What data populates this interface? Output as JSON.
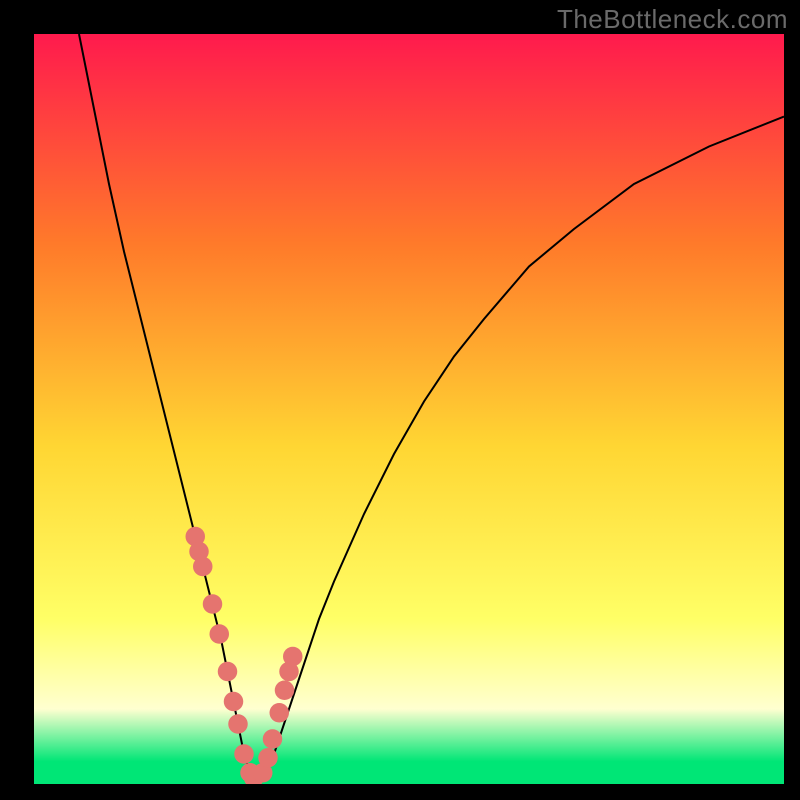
{
  "watermark": "TheBottleneck.com",
  "colors": {
    "black": "#000000",
    "curve": "#000000",
    "dot": "#e5746f",
    "grad_top": "#ff1a4d",
    "grad_mid1": "#ff7a2a",
    "grad_mid2": "#ffd633",
    "grad_mid3": "#ffff66",
    "grad_pale": "#ffffd0",
    "grad_green": "#00e676"
  },
  "chart_data": {
    "type": "line",
    "title": "",
    "xlabel": "",
    "ylabel": "",
    "xlim": [
      0,
      100
    ],
    "ylim": [
      0,
      100
    ],
    "series": [
      {
        "name": "bottleneck-curve",
        "x": [
          6,
          8,
          10,
          12,
          14,
          16,
          18,
          20,
          22,
          23,
          24,
          25,
          26,
          27,
          28,
          29,
          30,
          31,
          32,
          34,
          36,
          38,
          40,
          44,
          48,
          52,
          56,
          60,
          66,
          72,
          80,
          90,
          100
        ],
        "y": [
          100,
          90,
          80,
          71,
          63,
          55,
          47,
          39,
          31,
          27,
          23,
          19,
          14,
          9,
          4,
          1,
          0,
          1,
          4,
          10,
          16,
          22,
          27,
          36,
          44,
          51,
          57,
          62,
          69,
          74,
          80,
          85,
          89
        ]
      }
    ],
    "dots": {
      "name": "highlight-points",
      "x": [
        21.5,
        22.0,
        22.5,
        23.8,
        24.7,
        25.8,
        26.6,
        27.2,
        28.0,
        28.8,
        29.3,
        30.5,
        31.2,
        31.8,
        32.7,
        33.4,
        34.0,
        34.5
      ],
      "y": [
        33.0,
        31.0,
        29.0,
        24.0,
        20.0,
        15.0,
        11.0,
        8.0,
        4.0,
        1.5,
        0.8,
        1.5,
        3.5,
        6.0,
        9.5,
        12.5,
        15.0,
        17.0
      ],
      "r": 1.3
    }
  }
}
